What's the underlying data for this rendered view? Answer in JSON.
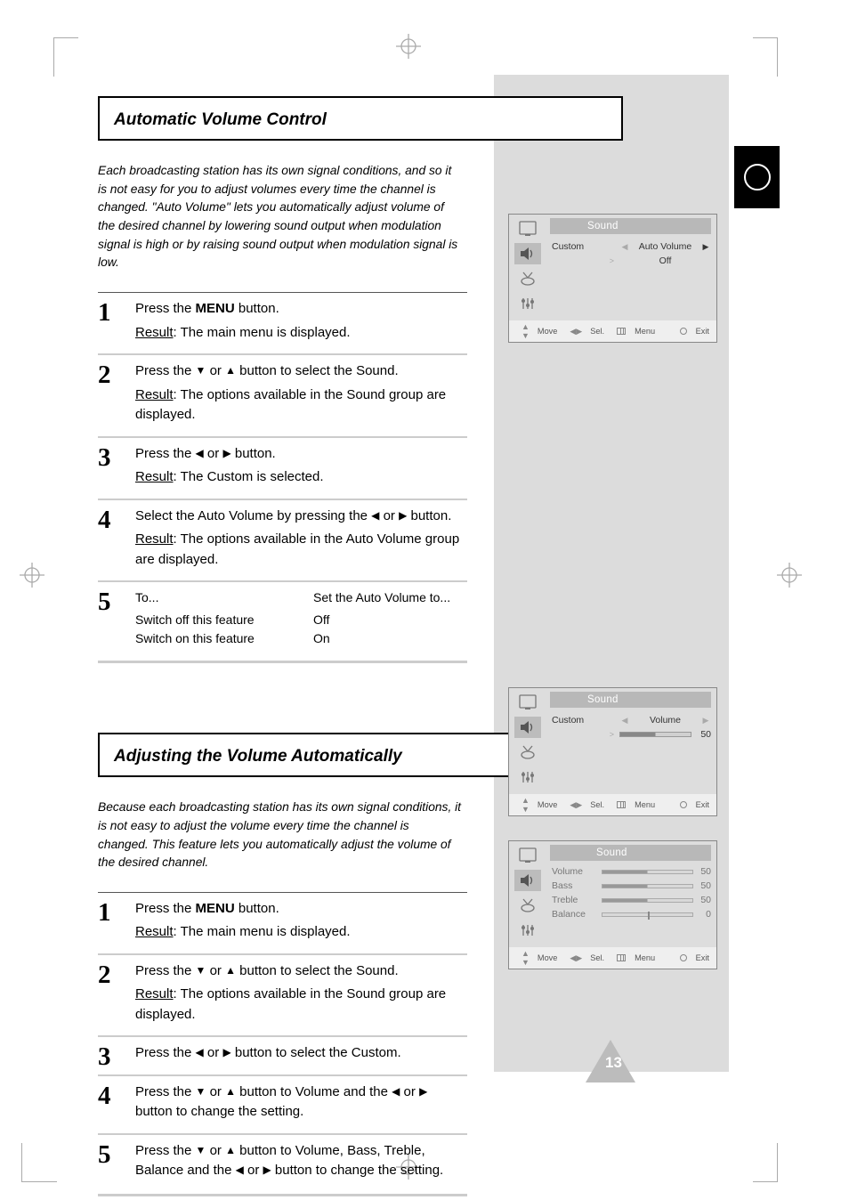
{
  "page_number": "13",
  "section1": {
    "title": "Automatic Volume Control",
    "intro": "Each broadcasting station has its own signal conditions, and so it is not easy for you to adjust volumes every time the channel is changed. \"Auto Volume\" lets you automatically adjust volume of the desired channel by lowering sound output when modulation signal is high or by raising sound output when modulation signal is low.",
    "steps": [
      {
        "num": "1",
        "body_pre": "Press the ",
        "body_btn": "MENU",
        "body_post": " button.",
        "result": "The main menu is displayed."
      },
      {
        "num": "2",
        "body_pre": "Press the ",
        "tri1": "▼",
        "mid": " or ",
        "tri2": "▲",
        "body_post": " button to select the Sound.",
        "result": "The options available in the Sound group are displayed."
      },
      {
        "num": "3",
        "body_pre": "Press the ",
        "tri1": "◀",
        "mid": " or ",
        "tri2": "▶",
        "body_post": " button.",
        "result": "The Custom is selected."
      },
      {
        "num": "4",
        "body_pre": "Select the Auto Volume by pressing the ",
        "tri1": "◀",
        "mid": " or ",
        "tri2": "▶",
        "body_post": " button.",
        "result": "The options available in the Auto Volume group are displayed."
      },
      {
        "num": "5",
        "body_pre": "To...",
        "table": [
          {
            "l": "Switch off this feature",
            "r": "Off"
          },
          {
            "l": "Switch on this feature",
            "r": "On"
          }
        ],
        "table_header_r": "Set the Auto Volume to..."
      }
    ]
  },
  "section2": {
    "title": "Adjusting the Volume Automatically",
    "intro": "Because each broadcasting station has its own signal conditions, it is not easy to adjust the volume every time the channel is changed. This feature lets you automatically adjust the volume of the desired channel.",
    "steps": [
      {
        "num": "1",
        "body_pre": "Press the ",
        "body_btn": "MENU",
        "body_post": " button.",
        "result": "The main menu is displayed."
      },
      {
        "num": "2",
        "body_pre": "Press the ",
        "tri1": "▼",
        "mid": " or ",
        "tri2": "▲",
        "body_post": " button to select the Sound.",
        "result": "The options available in the Sound group are displayed."
      },
      {
        "num": "3",
        "body_pre": "Press the ",
        "tri1": "◀",
        "mid": " or ",
        "tri2": "▶",
        "body_post": " button to select the Custom."
      },
      {
        "num": "4",
        "body_pre": "Press the ",
        "tri1": "▼",
        "mid": " or ",
        "tri2": "▲",
        "body_post": " button to Volume and the ",
        "tri3": "◀",
        "mid2": " or ",
        "tri4": "▶",
        "body_post2": " button to change the setting."
      },
      {
        "num": "5",
        "body_pre": "Press the ",
        "tri1": "▼",
        "mid": " or ",
        "tri2": "▲",
        "body_post": " button to Volume, Bass, Treble, Balance and the ",
        "tri3": "◀",
        "mid2": " or ",
        "tri4": "▶",
        "body_post2": " button to change the setting."
      }
    ]
  },
  "osd1": {
    "title": "Sound",
    "rows": [
      {
        "label": "Custom",
        "left": "◀",
        "val": "Auto Volume",
        "right": "▶",
        "active": true,
        "arrow": ">"
      },
      {
        "label": "",
        "left": "",
        "val": "Off",
        "right": "",
        "active": true,
        "arrow": ">"
      }
    ],
    "footer": {
      "move": "Move",
      "sel": "Sel.",
      "menu": "Menu",
      "exit": "Exit"
    }
  },
  "osd2": {
    "title": "Sound",
    "rows": [
      {
        "label": "Custom",
        "left": "◀",
        "val": "Volume",
        "right": "▶",
        "active": true
      },
      {
        "label": "50",
        "bar": true
      }
    ],
    "footer": {
      "move": "Move",
      "sel": "Sel.",
      "menu": "Menu",
      "exit": "Exit"
    }
  },
  "osd3": {
    "title": "Sound",
    "rows": [
      {
        "label": "Volume",
        "val": "50"
      },
      {
        "label": "Bass",
        "val": "50"
      },
      {
        "label": "Treble",
        "val": "50"
      },
      {
        "label": "Balance",
        "val": "0"
      }
    ],
    "footer": {
      "move": "Move",
      "sel": "Sel.",
      "menu": "Menu",
      "exit": "Exit"
    }
  }
}
